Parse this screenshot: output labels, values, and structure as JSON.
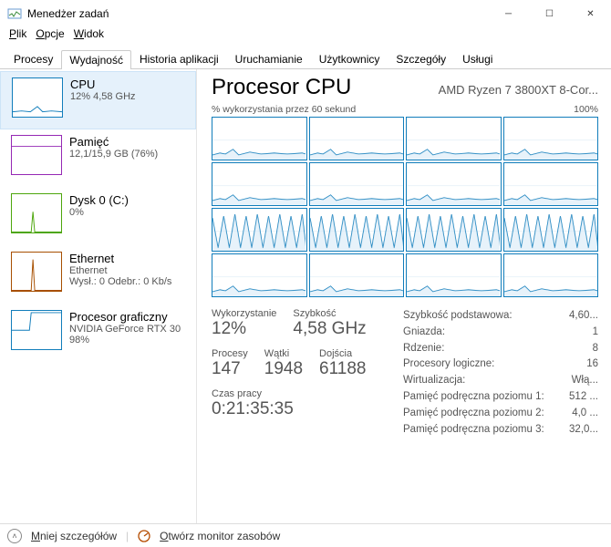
{
  "window": {
    "title": "Menedżer zadań"
  },
  "menu": {
    "file": "Plik",
    "options": "Opcje",
    "view": "Widok"
  },
  "tabs": [
    "Procesy",
    "Wydajność",
    "Historia aplikacji",
    "Uruchamianie",
    "Użytkownicy",
    "Szczegóły",
    "Usługi"
  ],
  "active_tab_index": 1,
  "sidebar": [
    {
      "name": "CPU",
      "sub": "12%  4,58 GHz"
    },
    {
      "name": "Pamięć",
      "sub": "12,1/15,9 GB (76%)"
    },
    {
      "name": "Dysk 0 (C:)",
      "sub": "0%"
    },
    {
      "name": "Ethernet",
      "sub": "Ethernet",
      "sub2": "Wysł.: 0  Odebr.: 0 Kb/s"
    },
    {
      "name": "Procesor graficzny",
      "sub": "NVIDIA GeForce RTX 30",
      "sub2": "98%"
    }
  ],
  "main": {
    "title": "Procesor CPU",
    "model": "AMD Ryzen 7 3800XT 8-Cor...",
    "chart_caption_left": "% wykorzystania przez 60 sekund",
    "chart_caption_right": "100%",
    "stats_left": {
      "util_label": "Wykorzystanie",
      "util_value": "12%",
      "speed_label": "Szybkość",
      "speed_value": "4,58 GHz",
      "proc_label": "Procesy",
      "proc_value": "147",
      "thread_label": "Wątki",
      "thread_value": "1948",
      "handle_label": "Dojścia",
      "handle_value": "61188",
      "uptime_label": "Czas pracy",
      "uptime_value": "0:21:35:35"
    },
    "stats_right": [
      {
        "k": "Szybkość podstawowa:",
        "v": "4,60..."
      },
      {
        "k": "Gniazda:",
        "v": "1"
      },
      {
        "k": "Rdzenie:",
        "v": "8"
      },
      {
        "k": "Procesory logiczne:",
        "v": "16"
      },
      {
        "k": "Wirtualizacja:",
        "v": "Włą..."
      },
      {
        "k": "Pamięć podręczna poziomu 1:",
        "v": "512 ..."
      },
      {
        "k": "Pamięć podręczna poziomu 2:",
        "v": "4,0 ..."
      },
      {
        "k": "Pamięć podręczna poziomu 3:",
        "v": "32,0..."
      }
    ]
  },
  "footer": {
    "fewer": "Mniej szczegółów",
    "resmon": "Otwórz monitor zasobów"
  },
  "chart_data": {
    "type": "line",
    "description": "16 logical-processor utilization sparkcharts over 60 seconds, y-range 0-100%",
    "cores_approx_current_pct": [
      15,
      18,
      12,
      14,
      20,
      10,
      16,
      12,
      95,
      92,
      90,
      88,
      14,
      18,
      22,
      10
    ],
    "rows_8_to_11_pattern": "high oscillating ~30-100%",
    "other_rows_pattern": "low ~10-25% with occasional spikes"
  }
}
